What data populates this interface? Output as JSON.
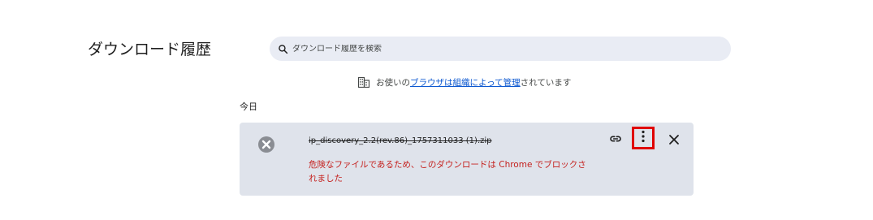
{
  "header": {
    "title": "ダウンロード履歴"
  },
  "search": {
    "placeholder": "ダウンロード履歴を検索",
    "icon": "search-icon"
  },
  "managed_notice": {
    "icon": "building-icon",
    "prefix": "お使いの",
    "link_text": "ブラウザは組織によって管理",
    "suffix": "されています"
  },
  "downloads": {
    "date_header": "今日",
    "items": [
      {
        "status_icon": "blocked-x-icon",
        "file_name": "ip_discovery_2.2(rev.86)_1757311033 (1).zip",
        "danger_message": "危険なファイルであるため、このダウンロードは Chrome でブロックされました",
        "actions": {
          "copy_link_icon": "link-icon",
          "more_icon": "more-vert-icon",
          "remove_icon": "close-icon"
        }
      }
    ]
  },
  "colors": {
    "card_background": "#dfe3eb",
    "danger_text": "#c5221f",
    "link": "#0b57d0",
    "highlight_border": "#e00000",
    "search_background": "#e9ecf4"
  }
}
